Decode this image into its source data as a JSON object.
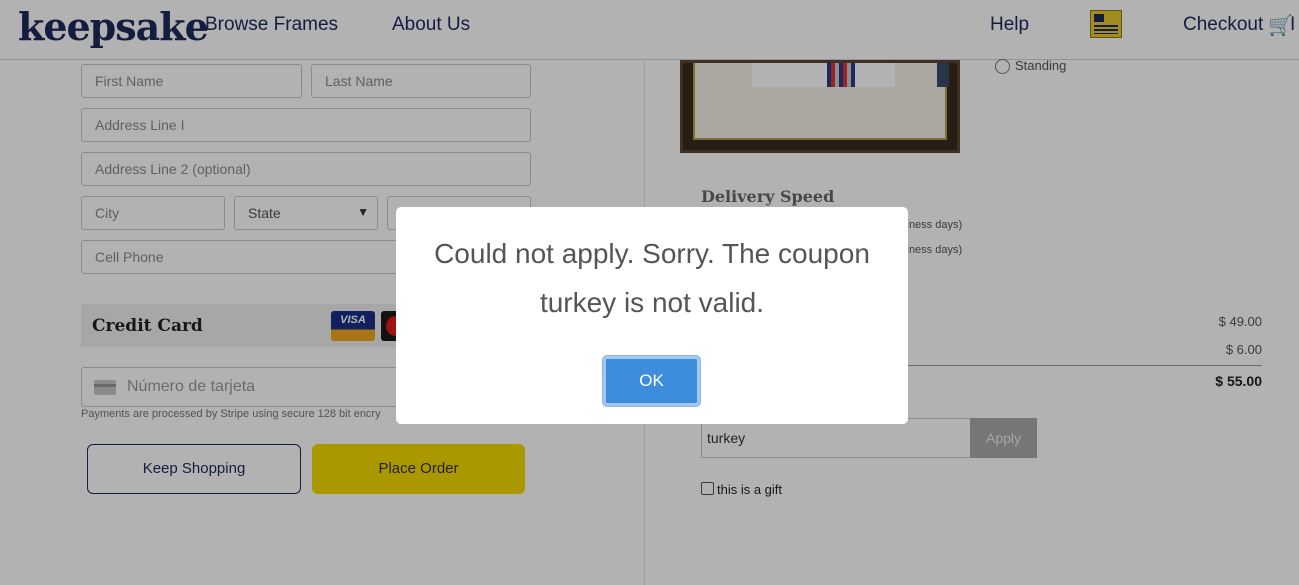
{
  "header": {
    "logo": "keepsake",
    "nav_browse": "Browse Frames",
    "nav_about": "About Us",
    "nav_help": "Help",
    "nav_checkout": "Checkout",
    "nav_trailing": "I"
  },
  "form": {
    "first_name_placeholder": "First Name",
    "last_name_placeholder": "Last Name",
    "address1_placeholder": "Address Line I",
    "address2_placeholder": "Address Line 2 (optional)",
    "city_placeholder": "City",
    "state_value": "State",
    "cell_placeholder": "Cell Phone"
  },
  "payment": {
    "title": "Credit Card",
    "visa_label": "VISA",
    "card_placeholder": "Número de tarjeta",
    "stripe_note": "Payments are processed by Stripe using secure 128 bit encry"
  },
  "actions": {
    "keep_shopping": "Keep Shopping",
    "place_order": "Place Order"
  },
  "order": {
    "standing_label": "Standing",
    "delivery_title": "Delivery Speed",
    "delivery_option_1": "siness days)",
    "delivery_option_2": "siness days)",
    "subtotal": "$ 49.00",
    "shipping": "$ 6.00",
    "total": "$ 55.00",
    "coupon_value": "turkey",
    "apply_label": "Apply",
    "gift_label": "this is a gift"
  },
  "modal": {
    "message": "Could not apply. Sorry. The coupon turkey is not valid.",
    "ok_label": "OK"
  },
  "colors": {
    "brand_navy": "#1d2a5c",
    "place_order_yellow": "#f5d800",
    "ok_blue": "#3e8ddd"
  },
  "icons": [
    "flag-icon",
    "cart-icon",
    "visa-icon",
    "mastercard-icon",
    "card-icon",
    "chevron-down-icon"
  ]
}
